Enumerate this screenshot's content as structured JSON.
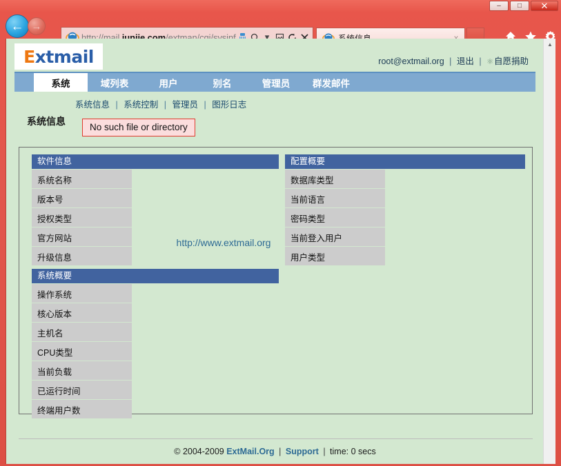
{
  "browser": {
    "url_prefix": "http://mail.",
    "url_domain": "junjie.com",
    "url_suffix": "/extman/cgi/sysinfo.cgi?sid",
    "url_full": "http://mail.junjie.com/extman/cgi/sysinfo.cgi?sid",
    "tab_title": "系统信息",
    "tab_close_label": "x",
    "minimize_label": "–",
    "maximize_label": "□",
    "close_label": "✕",
    "back_glyph": "←",
    "forward_glyph": "→",
    "addr_icons": {
      "compat_view": "☰",
      "search": "⌕",
      "dropdown": "▾",
      "page": "⛶",
      "refresh": "↻",
      "stop": "✕"
    },
    "tool_icons": {
      "home": "⌂",
      "favorites": "★",
      "settings": "⚙"
    },
    "scroll_up": "▲",
    "scroll_down": "▼"
  },
  "header": {
    "logo_first_letter": "E",
    "logo_rest": "xtmail",
    "user_email": "root@extmail.org",
    "logout_label": "退出",
    "donate_label": "自愿捐助",
    "donate_icon_glyph": "⚛",
    "separator": "|"
  },
  "mainnav": {
    "items": [
      {
        "label": "系统",
        "active": true
      },
      {
        "label": "域列表",
        "active": false
      },
      {
        "label": "用户",
        "active": false
      },
      {
        "label": "别名",
        "active": false
      },
      {
        "label": "管理员",
        "active": false
      },
      {
        "label": "群发邮件",
        "active": false
      }
    ]
  },
  "subnav": {
    "items": [
      "系统信息",
      "系统控制",
      "管理员",
      "图形日志"
    ],
    "separator": "|"
  },
  "page": {
    "title": "系统信息",
    "error_message": "No such file or directory"
  },
  "tables": {
    "software": {
      "heading": "软件信息",
      "rows": [
        {
          "label": "系统名称",
          "value": ""
        },
        {
          "label": "版本号",
          "value": ""
        },
        {
          "label": "授权类型",
          "value": ""
        },
        {
          "label": "官方网站",
          "value": ""
        },
        {
          "label": "升级信息",
          "value": ""
        }
      ],
      "website_value": "http://www.extmail.org"
    },
    "config": {
      "heading": "配置概要",
      "rows": [
        {
          "label": "数据库类型",
          "value": ""
        },
        {
          "label": "当前语言",
          "value": ""
        },
        {
          "label": "密码类型",
          "value": ""
        },
        {
          "label": "当前登入用户",
          "value": ""
        },
        {
          "label": "用户类型",
          "value": ""
        }
      ]
    },
    "sysinfo": {
      "heading": "系统概要",
      "rows": [
        {
          "label": "操作系统",
          "value": ""
        },
        {
          "label": "核心版本",
          "value": ""
        },
        {
          "label": "主机名",
          "value": ""
        },
        {
          "label": "CPU类型",
          "value": ""
        },
        {
          "label": "当前负载",
          "value": ""
        },
        {
          "label": "已运行时间",
          "value": ""
        },
        {
          "label": "终端用户数",
          "value": ""
        }
      ]
    }
  },
  "footer": {
    "copyright": "© 2004-2009",
    "org_link": "ExtMail.Org",
    "support_link": "Support",
    "time_text": "time: 0 secs",
    "separator": "|"
  },
  "colors": {
    "page_bg": "#d3e8d0",
    "nav_blue": "#7fa9d0",
    "table_head_blue": "#41639f",
    "label_gray": "#cccccc",
    "error_bg": "#fbdddd",
    "error_border": "#e03a2e",
    "link_blue": "#2d6a94",
    "logo_orange": "#ee7711",
    "logo_blue": "#2a5ea8",
    "chrome_red": "#e8564b"
  }
}
